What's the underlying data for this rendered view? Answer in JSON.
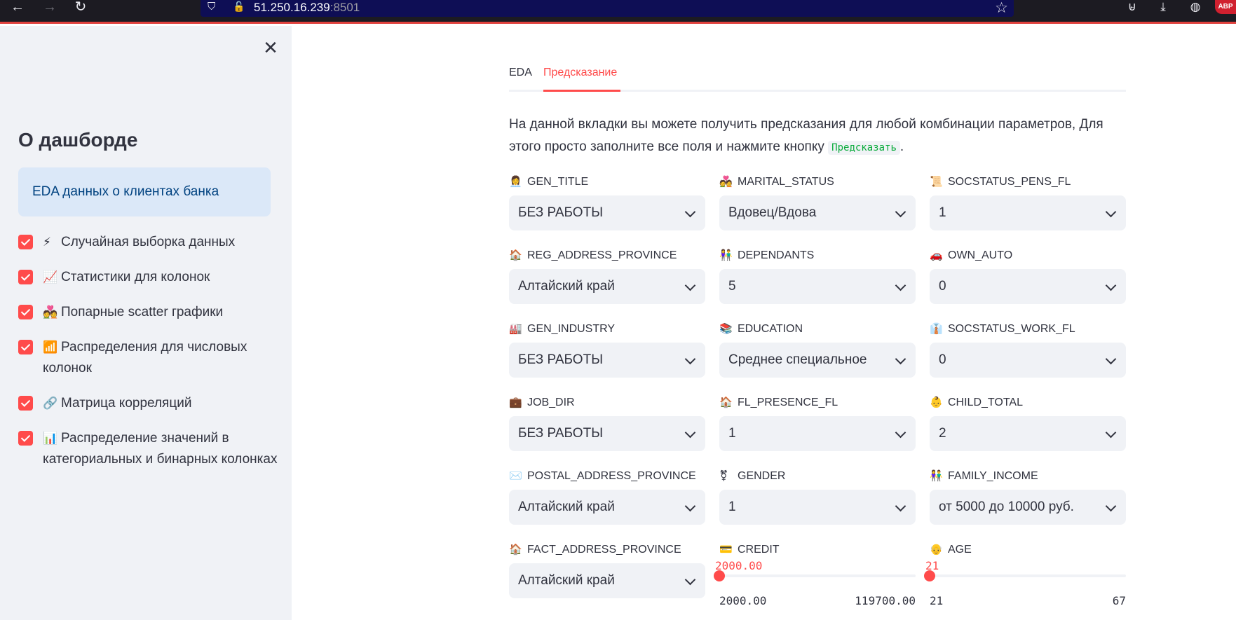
{
  "browser": {
    "url_host": "51.250.16.239",
    "url_port": ":8501",
    "abp_label": "ABP"
  },
  "sidebar": {
    "close_glyph": "✕",
    "title": "О дашборде",
    "info": "EDA данных о клиентах банка",
    "checkboxes": [
      {
        "emoji": "⚡",
        "label": "Случайная выборка данных",
        "checked": true
      },
      {
        "emoji": "📈",
        "label": "Статистики для колонок",
        "checked": true
      },
      {
        "emoji": "💑",
        "label": "Попарные scatter графики",
        "checked": true
      },
      {
        "emoji": "📶",
        "label": "Распределения для числовых колонок",
        "checked": true
      },
      {
        "emoji": "🔗",
        "label": "Матрица корреляций",
        "checked": true
      },
      {
        "emoji": "📊",
        "label": "Распределение значений в категориальных и бинарных колонках",
        "checked": true
      }
    ]
  },
  "tabs": [
    {
      "label": "EDA",
      "active": false
    },
    {
      "label": "Предсказание",
      "active": true
    }
  ],
  "intro": {
    "text": "На данной вкладки вы можете получить предсказания для любой комбинации параметров, Для этого просто заполните все поля и нажмите кнопку",
    "code": "Предсказать",
    "suffix": "."
  },
  "fields": [
    {
      "emoji": "👩‍💼",
      "label": "GEN_TITLE",
      "value": "БЕЗ РАБОТЫ"
    },
    {
      "emoji": "💑",
      "label": "MARITAL_STATUS",
      "value": "Вдовец/Вдова"
    },
    {
      "emoji": "📜",
      "label": "SOCSTATUS_PENS_FL",
      "value": "1"
    },
    {
      "emoji": "🏠",
      "label": "REG_ADDRESS_PROVINCE",
      "value": "Алтайский край"
    },
    {
      "emoji": "👫",
      "label": "DEPENDANTS",
      "value": "5"
    },
    {
      "emoji": "🚗",
      "label": "OWN_AUTO",
      "value": "0"
    },
    {
      "emoji": "🏭",
      "label": "GEN_INDUSTRY",
      "value": "БЕЗ РАБОТЫ"
    },
    {
      "emoji": "📚",
      "label": "EDUCATION",
      "value": "Среднее специальное"
    },
    {
      "emoji": "👔",
      "label": "SOCSTATUS_WORK_FL",
      "value": "0"
    },
    {
      "emoji": "💼",
      "label": "JOB_DIR",
      "value": "БЕЗ РАБОТЫ"
    },
    {
      "emoji": "🏠",
      "label": "FL_PRESENCE_FL",
      "value": "1"
    },
    {
      "emoji": "👶",
      "label": "CHILD_TOTAL",
      "value": "2"
    },
    {
      "emoji": "✉️",
      "label": "POSTAL_ADDRESS_PROVINCE",
      "value": "Алтайский край"
    },
    {
      "emoji": "⚧",
      "label": "GENDER",
      "value": "1"
    },
    {
      "emoji": "👫",
      "label": "FAMILY_INCOME",
      "value": "от 5000 до 10000 руб."
    },
    {
      "emoji": "🏠",
      "label": "FACT_ADDRESS_PROVINCE",
      "value": "Алтайский край"
    }
  ],
  "sliders": [
    {
      "emoji": "💳",
      "label": "CREDIT",
      "value": "2000.00",
      "min": "2000.00",
      "max": "119700.00",
      "fraction": 0
    },
    {
      "emoji": "👴",
      "label": "AGE",
      "value": "21",
      "min": "21",
      "max": "67",
      "fraction": 0
    }
  ]
}
